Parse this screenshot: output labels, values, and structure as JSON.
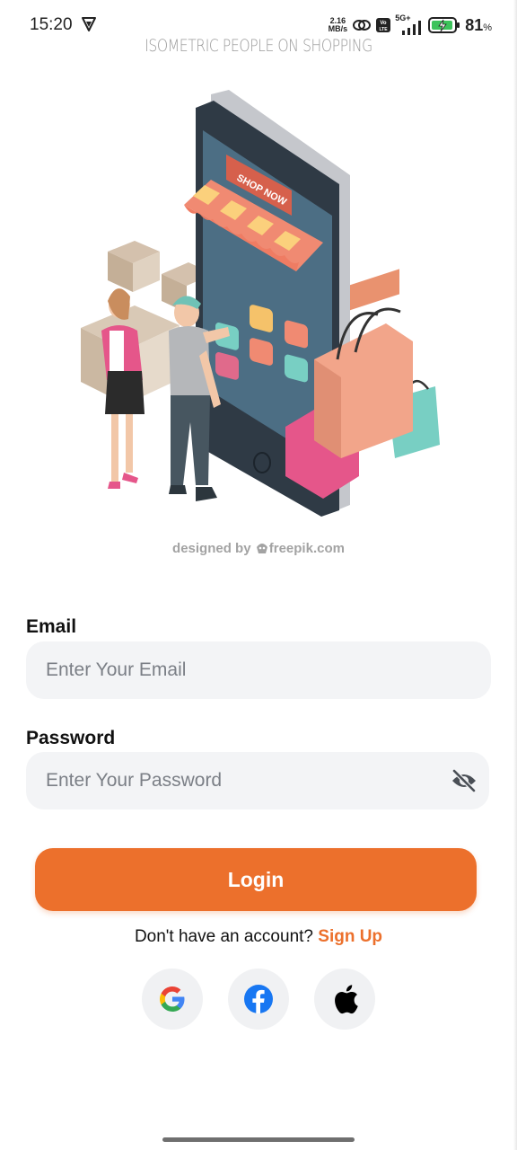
{
  "status_bar": {
    "time": "15:20",
    "net_speed_value": "2.16",
    "net_speed_unit": "MB/s",
    "network_type": "5G+",
    "volte": "Vo LTE",
    "battery_percent": "81",
    "battery_unit": "%"
  },
  "hero": {
    "caption": "ISOMETRIC PEOPLE ON SHOPPING",
    "sign_text": "SHOP NOW",
    "credit_prefix": "designed by",
    "credit_site": "freepik.com"
  },
  "form": {
    "email_label": "Email",
    "email_placeholder": "Enter Your Email",
    "email_value": "",
    "password_label": "Password",
    "password_placeholder": "Enter Your Password",
    "password_value": "",
    "password_toggle_icon": "eye-off-icon"
  },
  "login_button": "Login",
  "signup": {
    "prompt": "Don't have an account?",
    "link": "Sign Up"
  },
  "social": [
    {
      "name": "google",
      "icon": "google-icon"
    },
    {
      "name": "facebook",
      "icon": "facebook-icon"
    },
    {
      "name": "apple",
      "icon": "apple-icon"
    }
  ],
  "colors": {
    "accent": "#ec702c",
    "field_bg": "#f3f4f6",
    "social_bg": "#f0f1f3",
    "facebook": "#1877f2"
  }
}
